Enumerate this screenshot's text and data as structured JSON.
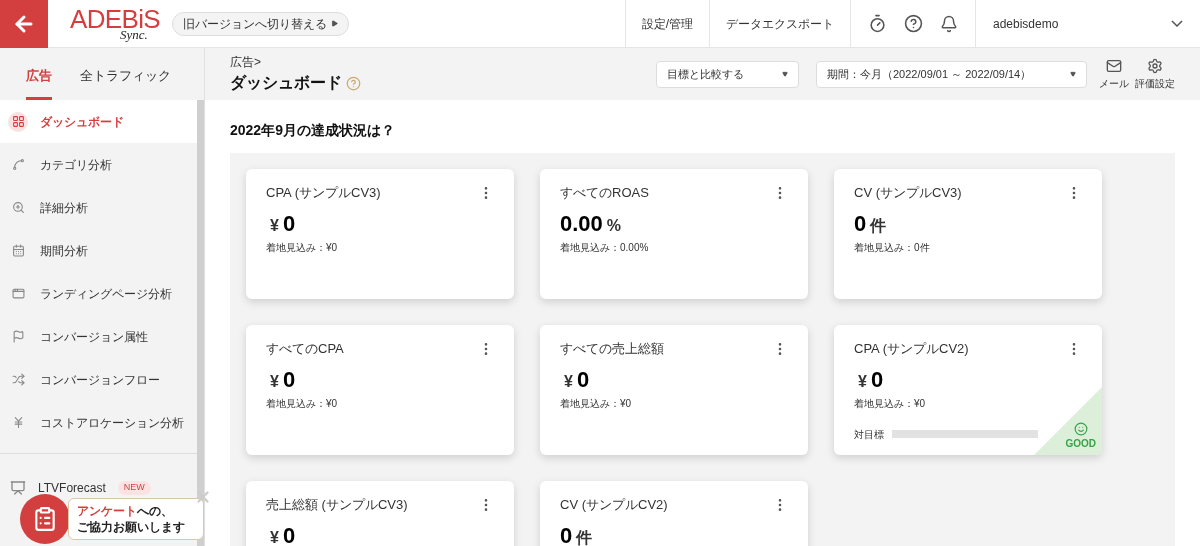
{
  "header": {
    "logo": "ADEBiS",
    "logo_sub": "Sync.",
    "version_switch": "旧バージョンへ切り替える",
    "nav": [
      "設定/管理",
      "データエクスポート"
    ],
    "user": "adebisdemo"
  },
  "tabs": [
    {
      "label": "広告",
      "selected": true
    },
    {
      "label": "全トラフィック",
      "selected": false
    }
  ],
  "breadcrumb": "広告>",
  "page_title": "ダッシュボード",
  "compare_select": "目標と比較する",
  "period_select": "期間：今月（2022/09/01 ～ 2022/09/14）",
  "tools": [
    {
      "kind": "mail",
      "label": "メール"
    },
    {
      "kind": "settings",
      "label": "評価設定"
    }
  ],
  "sidebar": {
    "items": [
      {
        "kind": "grid",
        "label": "ダッシュボード",
        "selected": true
      },
      {
        "kind": "category",
        "label": "カテゴリ分析",
        "selected": false
      },
      {
        "kind": "detail",
        "label": "詳細分析",
        "selected": false
      },
      {
        "kind": "calendar",
        "label": "期間分析",
        "selected": false
      },
      {
        "kind": "page",
        "label": "ランディングページ分析",
        "selected": false
      },
      {
        "kind": "flag",
        "label": "コンバージョン属性",
        "selected": false
      },
      {
        "kind": "flow",
        "label": "コンバージョンフロー",
        "selected": false
      },
      {
        "kind": "yen",
        "label": "コストアロケーション分析",
        "selected": false
      }
    ],
    "extra": {
      "label": "LTVForecast",
      "badge": "NEW"
    }
  },
  "survey": {
    "highlight": "アンケート",
    "rest": "への、",
    "line2": "ご協力お願いします"
  },
  "section_title": "2022年9月の達成状況は？",
  "cards": [
    {
      "title": "CPA (サンプルCV3)",
      "unit_before": "¥",
      "value": "0",
      "forecast": "着地見込み：¥0"
    },
    {
      "title": "すべてのROAS",
      "unit_after": "%",
      "value": "0.00",
      "forecast": "着地見込み：0.00%"
    },
    {
      "title": "CV (サンプルCV3)",
      "unit_after": "件",
      "value": "0",
      "forecast": "着地見込み：0件"
    },
    {
      "title": "すべてのCPA",
      "unit_before": "¥",
      "value": "0",
      "forecast": "着地見込み：¥0"
    },
    {
      "title": "すべての売上総額",
      "unit_before": "¥",
      "value": "0",
      "forecast": "着地見込み：¥0"
    },
    {
      "title": "CPA (サンプルCV2)",
      "unit_before": "¥",
      "value": "0",
      "forecast": "着地見込み：¥0",
      "target": {
        "label": "対目標",
        "level": 0
      },
      "status": {
        "kind": "good",
        "label": "GOOD"
      }
    },
    {
      "title": "売上総額 (サンプルCV3)",
      "unit_before": "¥",
      "value": "0"
    },
    {
      "title": "CV (サンプルCV2)",
      "unit_after": "件",
      "value": "0"
    }
  ]
}
